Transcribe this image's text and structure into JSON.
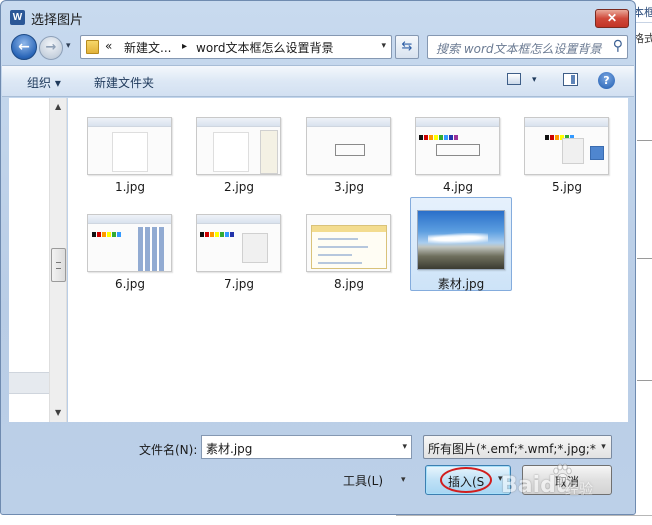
{
  "window": {
    "title": "选择图片",
    "app_icon_letter": "W",
    "close_glyph": "✕"
  },
  "nav": {
    "back_glyph": "←",
    "forward_glyph": "→",
    "dropdown_glyph": "▾"
  },
  "address": {
    "overflow": "«",
    "crumb_1": "新建文...",
    "separator": "▸",
    "crumb_2": "word文本框怎么设置背景",
    "dropdown_glyph": "▾",
    "refresh_glyph": "⇆"
  },
  "search": {
    "placeholder": "搜索 word文本框怎么设置背景",
    "icon": "search-icon",
    "icon_glyph": "⚲"
  },
  "toolbar": {
    "organize_label": "组织 ▾",
    "new_folder_label": "新建文件夹",
    "view_dropdown_glyph": "▾",
    "help_glyph": "?"
  },
  "scrollbar": {
    "up_glyph": "▲",
    "down_glyph": "▼"
  },
  "files": [
    {
      "name": "1.jpg"
    },
    {
      "name": "2.jpg"
    },
    {
      "name": "3.jpg"
    },
    {
      "name": "4.jpg"
    },
    {
      "name": "5.jpg"
    },
    {
      "name": "6.jpg"
    },
    {
      "name": "7.jpg"
    },
    {
      "name": "8.jpg"
    },
    {
      "name": "素材.jpg",
      "selected": true
    }
  ],
  "footer": {
    "filename_label": "文件名(N):",
    "filename_value": "素材.jpg",
    "filename_dropdown_glyph": "▾",
    "filter_value": "所有图片(*.emf;*.wmf;*.jpg;*.jpeg;*.png)",
    "filter_dropdown_glyph": "▾",
    "tools_label": "工具(L)",
    "tools_dropdown_glyph": "▾",
    "insert_label": "插入(S",
    "insert_dropdown_glyph": "▾",
    "cancel_label": "取消"
  },
  "background_doc": {
    "text_1": "本框",
    "text_2": "格式"
  },
  "watermark": {
    "brand": "Baidu",
    "sub": "经验"
  },
  "colors": {
    "accent": "#3c7fb1",
    "selection": "#cde3f8",
    "highlight_ring": "#d11e1e"
  }
}
